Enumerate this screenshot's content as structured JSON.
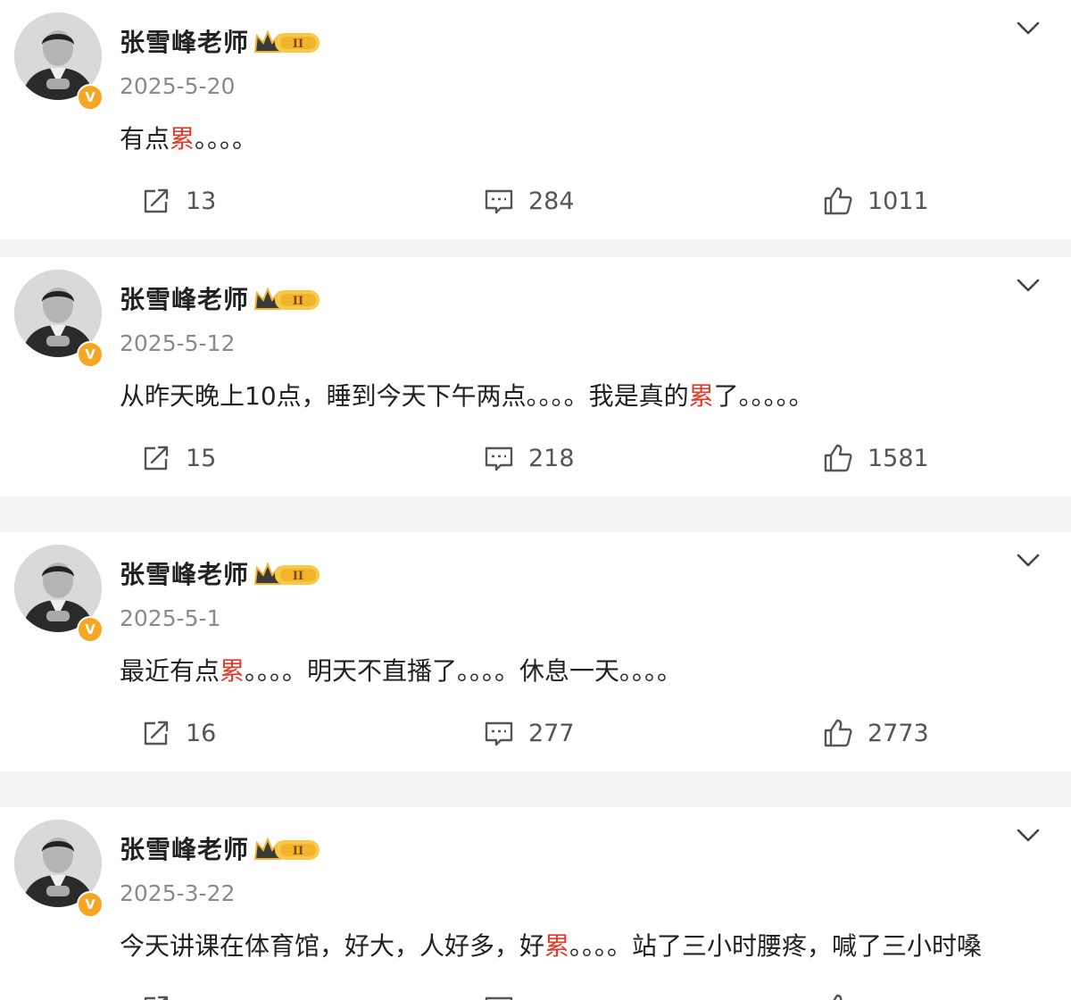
{
  "posts": [
    {
      "author": "张雪峰老师",
      "date": "2025-5-20",
      "text": [
        {
          "t": "有点",
          "hl": false
        },
        {
          "t": "累",
          "hl": true
        },
        {
          "t": "。。。。",
          "hl": false
        }
      ],
      "reposts": "13",
      "comments": "284",
      "likes": "1011"
    },
    {
      "author": "张雪峰老师",
      "date": "2025-5-12",
      "text": [
        {
          "t": "从昨天晚上10点，睡到今天下午两点。。。。我是真的",
          "hl": false
        },
        {
          "t": "累",
          "hl": true
        },
        {
          "t": "了。。。。。",
          "hl": false
        }
      ],
      "reposts": "15",
      "comments": "218",
      "likes": "1581"
    },
    {
      "author": "张雪峰老师",
      "date": "2025-5-1",
      "text": [
        {
          "t": "最近有点",
          "hl": false
        },
        {
          "t": "累",
          "hl": true
        },
        {
          "t": "。。。。明天不直播了。。。。休息一天。。。。",
          "hl": false
        }
      ],
      "reposts": "16",
      "comments": "277",
      "likes": "2773"
    },
    {
      "author": "张雪峰老师",
      "date": "2025-3-22",
      "text": [
        {
          "t": "今天讲课在体育馆，好大，人好多，好",
          "hl": false
        },
        {
          "t": "累",
          "hl": true
        },
        {
          "t": "。。。。站了三小时腰疼，喊了三小时嗓",
          "hl": false
        }
      ],
      "reposts": "",
      "comments": "",
      "likes": ""
    }
  ],
  "badge": {
    "verified_glyph": "V",
    "member_level": "II"
  },
  "icons": {
    "verified": "verified-v-icon",
    "member": "crown-member-badge-icon",
    "more": "chevron-down-icon",
    "repost": "repost-icon",
    "comment": "comment-icon",
    "like": "thumbs-up-icon"
  },
  "colors": {
    "highlight": "#e03c2c",
    "badge": "#f6a623",
    "divider": "#f2f2f2"
  }
}
